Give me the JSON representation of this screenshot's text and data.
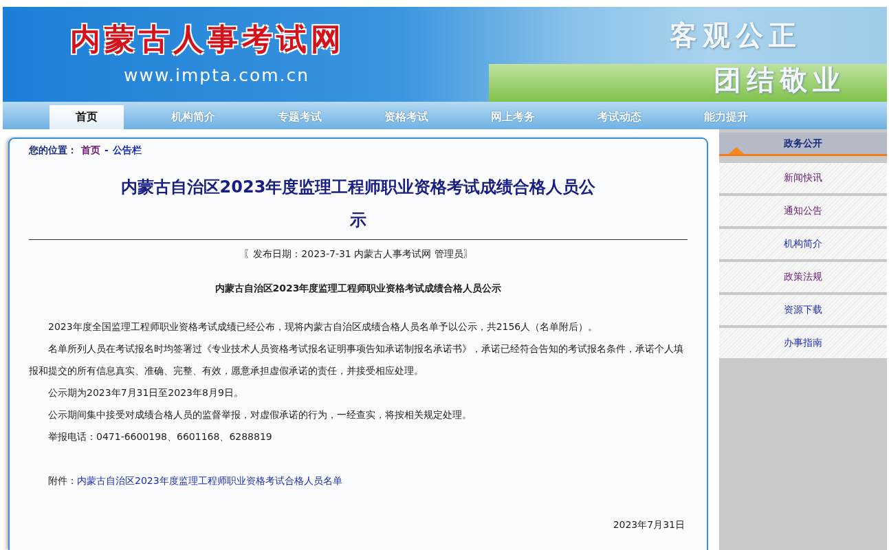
{
  "header": {
    "logo_text": "内蒙古人事考试网",
    "url": "www.impta.com.cn",
    "slogan": [
      "客观公正",
      "团结敬业"
    ]
  },
  "nav": [
    {
      "label": "首页",
      "selected": true
    },
    {
      "label": "机构简介",
      "selected": false
    },
    {
      "label": "专题考试",
      "selected": false
    },
    {
      "label": "资格考试",
      "selected": false
    },
    {
      "label": "网上考务",
      "selected": false
    },
    {
      "label": "考试动态",
      "selected": false
    },
    {
      "label": "能力提升",
      "selected": false
    }
  ],
  "breadcrumb": {
    "label": "您的位置：",
    "separator": "-",
    "items": [
      {
        "text": "首页",
        "visited": true
      },
      {
        "text": "公告栏",
        "visited": false
      }
    ]
  },
  "article": {
    "title": "内蒙古自治区2023年度监理工程师职业资格考试成绩合格人员公示",
    "meta": "〖发布日期：2023-7-31 内蒙古人事考试网 管理员〗",
    "subtitle": "内蒙古自治区2023年度监理工程师职业资格考试成绩合格人员公示",
    "paragraphs": [
      "2023年度全国监理工程师职业资格考试成绩已经公布，现将内蒙古自治区成绩合格人员名单予以公示，共2156人（名单附后）。",
      "名单所列人员在考试报名时均签署过《专业技术人员资格考试报名证明事项告知承诺制报名承诺书》，承诺已经符合告知的考试报名条件，承诺个人填报和提交的所有信息真实、准确、完整、有效，愿意承担虚假承诺的责任，并接受相应处理。",
      "公示期为2023年7月31日至2023年8月9日。",
      "公示期间集中接受对成绩合格人员的监督举报，对虚假承诺的行为，一经查实，将按相关规定处理。",
      "举报电话：0471-6600198、6601168、6288819"
    ],
    "attachment": {
      "label": "附件：",
      "link": "内蒙古自治区2023年度监理工程师职业资格考试合格人员名单"
    },
    "date": "2023年7月31日"
  },
  "sidebar": {
    "title": "政务公开",
    "items": [
      {
        "label": "新闻快讯",
        "visited": true
      },
      {
        "label": "通知公告",
        "visited": true
      },
      {
        "label": "机构简介",
        "visited": false
      },
      {
        "label": "政策法规",
        "visited": true
      },
      {
        "label": "资源下载",
        "visited": false
      },
      {
        "label": "办事指南",
        "visited": false
      }
    ]
  }
}
